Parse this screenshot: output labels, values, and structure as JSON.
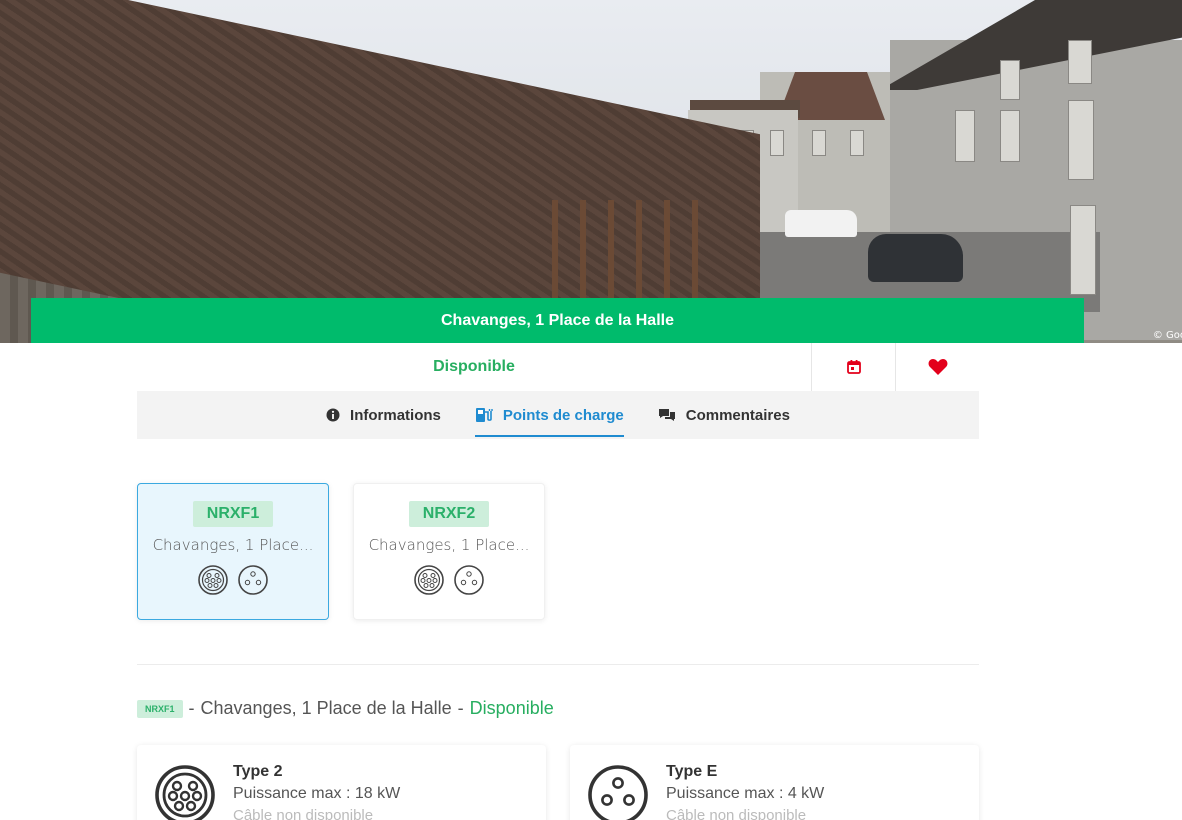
{
  "station": {
    "title": "Chavanges, 1 Place de la Halle",
    "status": "Disponible",
    "image_watermark": "© Goo"
  },
  "actions": {
    "calendar_icon": "calendar-icon",
    "favorite_icon": "heart-icon"
  },
  "tabs": [
    {
      "label": "Informations",
      "icon": "info-icon",
      "active": false
    },
    {
      "label": "Points de charge",
      "icon": "charging-station-icon",
      "active": true
    },
    {
      "label": "Commentaires",
      "icon": "comments-icon",
      "active": false
    }
  ],
  "charge_points": [
    {
      "id": "NRXF1",
      "address": "Chavanges, 1 Place...",
      "selected": true,
      "plugs": [
        "type2-plug-icon",
        "typeE-plug-icon"
      ]
    },
    {
      "id": "NRXF2",
      "address": "Chavanges, 1 Place...",
      "selected": false,
      "plugs": [
        "type2-plug-icon",
        "typeE-plug-icon"
      ]
    }
  ],
  "detail": {
    "badge": "NRXF1",
    "sep1": "-",
    "address": "Chavanges, 1 Place de la Halle",
    "sep2": "-",
    "status": "Disponible"
  },
  "connectors": [
    {
      "title": "Type 2",
      "power": "Puissance max : 18 kW",
      "cable": "Câble non disponible",
      "icon": "type2-plug-icon"
    },
    {
      "title": "Type E",
      "power": "Puissance max : 4 kW",
      "cable": "Câble non disponible",
      "icon": "typeE-plug-icon"
    }
  ],
  "colors": {
    "accent_green": "#00bb6c",
    "status_green": "#27ae60",
    "active_tab_blue": "#1f8bd0",
    "favorite_red": "#e3001b"
  }
}
